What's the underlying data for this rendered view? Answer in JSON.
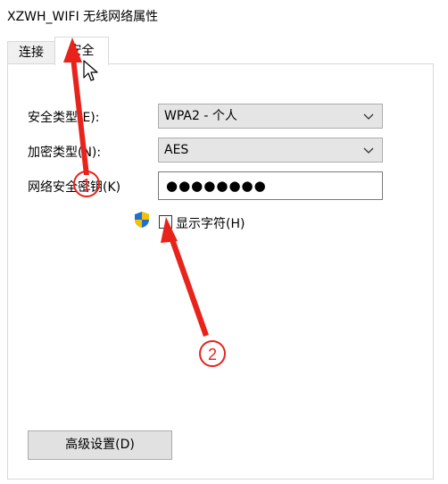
{
  "window": {
    "title": "XZWH_WIFI 无线网络属性"
  },
  "tabs": [
    {
      "label": "连接",
      "selected": false
    },
    {
      "label": "安全",
      "selected": true
    }
  ],
  "form": {
    "security_type_label": "安全类型(E):",
    "security_type_value": "WPA2 - 个人",
    "encryption_type_label": "加密类型(N):",
    "encryption_type_value": "AES",
    "network_key_label": "网络安全密钥(K)",
    "network_key_value": "●●●●●●●●",
    "show_characters_label": "显示字符(H)",
    "show_characters_checked": false,
    "advanced_button_label": "高级设置(D)"
  },
  "annotations": {
    "marker_1": "①",
    "marker_2": "②",
    "arrow_color": "#e8231c"
  },
  "colors": {
    "annotation_red": "#e8231c",
    "shield_blue": "#1f6fd1",
    "shield_yellow": "#f2c200"
  },
  "icons": {
    "dropdown": "chevron-down-icon",
    "shield": "uac-shield-icon",
    "cursor": "mouse-pointer-icon"
  }
}
